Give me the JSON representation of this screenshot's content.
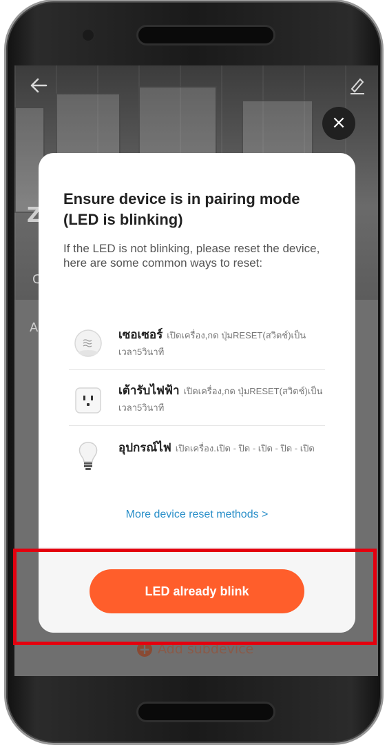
{
  "header": {
    "back_icon": "arrow-left-icon",
    "edit_icon": "pencil-icon"
  },
  "background": {
    "letter_title": "Z",
    "letter_sub": "C",
    "letter_list": "A",
    "add_subdevice_label": "Add subdevice"
  },
  "dialog": {
    "close_glyph": "×",
    "title": "Ensure device is in pairing mode (LED is blinking)",
    "description": "If the LED is not blinking, please reset the device, here are some common ways to reset:",
    "methods": [
      {
        "name": "เซอเซอร์",
        "instruction": "เปิดเครื่อง,กด ปุ่มRESET(สวิตช์)เป็นเวลา5วินาที",
        "icon": "sensor-icon"
      },
      {
        "name": "เต้ารับไฟฟ้า",
        "instruction": "เปิดเครื่อง,กด ปุ่มRESET(สวิตช์)เป็นเวลา5วินาที",
        "icon": "power-socket-icon"
      },
      {
        "name": "อุปกรณ์ไฟ",
        "instruction": "เปิดเครื่อง.เปิด - ปิด - เปิด - ปิด - เปิด",
        "icon": "light-bulb-icon"
      }
    ],
    "more_link": "More device reset methods >",
    "confirm_button": "LED already blink"
  },
  "colors": {
    "accent": "#ff5e2b",
    "link": "#2a8fc9",
    "highlight": "#e3000f"
  }
}
